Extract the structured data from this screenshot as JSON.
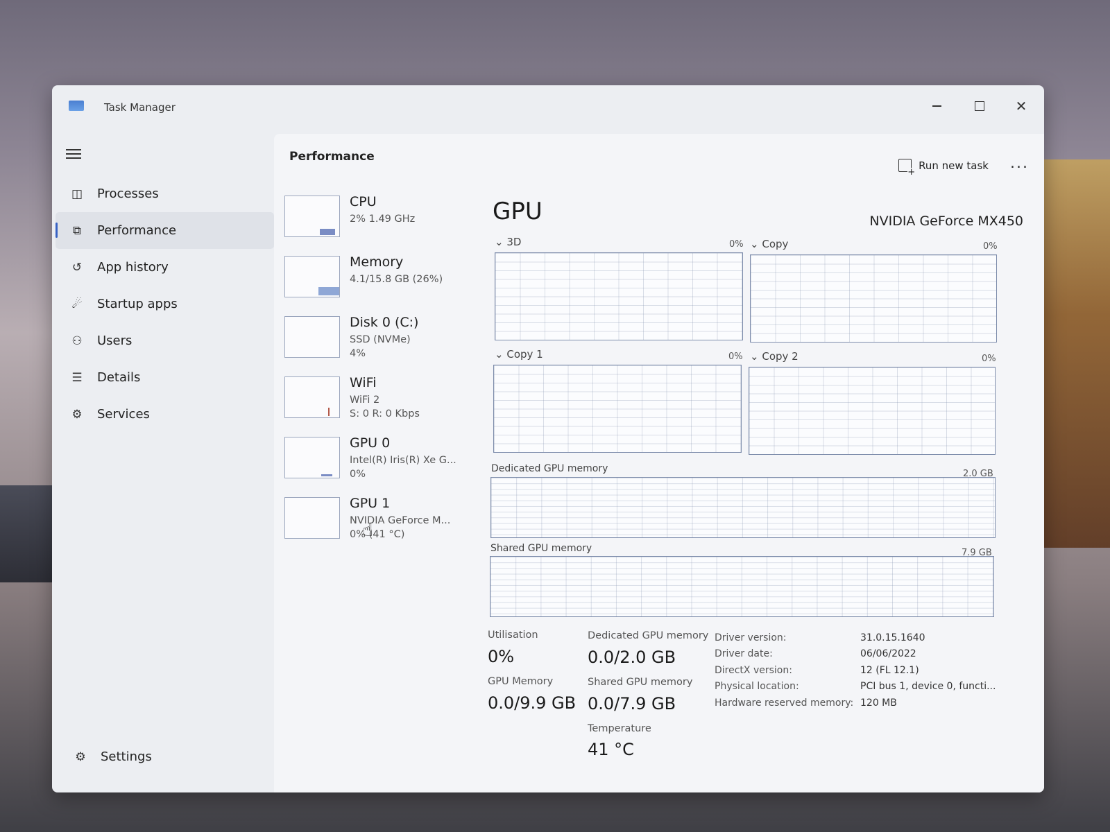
{
  "window": {
    "title": "Task Manager"
  },
  "nav": {
    "items": [
      {
        "label": "Processes"
      },
      {
        "label": "Performance"
      },
      {
        "label": "App history"
      },
      {
        "label": "Startup apps"
      },
      {
        "label": "Users"
      },
      {
        "label": "Details"
      },
      {
        "label": "Services"
      }
    ],
    "active": "Performance",
    "settings": "Settings"
  },
  "header": {
    "title": "Performance",
    "run_new_task": "Run new task",
    "more": "..."
  },
  "devices": [
    {
      "name": "CPU",
      "lines": [
        "2%  1.49 GHz"
      ]
    },
    {
      "name": "Memory",
      "lines": [
        "4.1/15.8 GB (26%)"
      ]
    },
    {
      "name": "Disk 0 (C:)",
      "lines": [
        "SSD (NVMe)",
        "4%"
      ]
    },
    {
      "name": "WiFi",
      "lines": [
        "WiFi 2",
        "S: 0  R: 0 Kbps"
      ]
    },
    {
      "name": "GPU 0",
      "lines": [
        "Intel(R) Iris(R) Xe G...",
        "0%"
      ]
    },
    {
      "name": "GPU 1",
      "lines": [
        "NVIDIA GeForce M...",
        "0%  (41 °C)"
      ]
    }
  ],
  "gpu": {
    "title": "GPU",
    "model": "NVIDIA GeForce MX450",
    "graphs": {
      "g3d": {
        "label": "3D",
        "pct": "0%"
      },
      "copy": {
        "label": "Copy",
        "pct": "0%"
      },
      "copy1": {
        "label": "Copy 1",
        "pct": "0%"
      },
      "copy2": {
        "label": "Copy 2",
        "pct": "0%"
      },
      "dedicated": {
        "label": "Dedicated GPU memory",
        "max": "2.0 GB"
      },
      "shared": {
        "label": "Shared GPU memory",
        "max": "7.9 GB"
      }
    },
    "stats": {
      "utilisation_label": "Utilisation",
      "utilisation": "0%",
      "dedicated_label": "Dedicated GPU memory",
      "dedicated": "0.0/2.0 GB",
      "gpu_memory_label": "GPU Memory",
      "gpu_memory": "0.0/9.9 GB",
      "shared_label": "Shared GPU memory",
      "shared": "0.0/7.9 GB",
      "temperature_label": "Temperature",
      "temperature": "41 °C"
    },
    "info": {
      "driver_version_label": "Driver version:",
      "driver_version": "31.0.15.1640",
      "driver_date_label": "Driver date:",
      "driver_date": "06/06/2022",
      "directx_label": "DirectX version:",
      "directx": "12 (FL 12.1)",
      "location_label": "Physical location:",
      "location": "PCI bus 1, device 0, functi...",
      "reserved_label": "Hardware reserved memory:",
      "reserved": "120 MB"
    }
  }
}
